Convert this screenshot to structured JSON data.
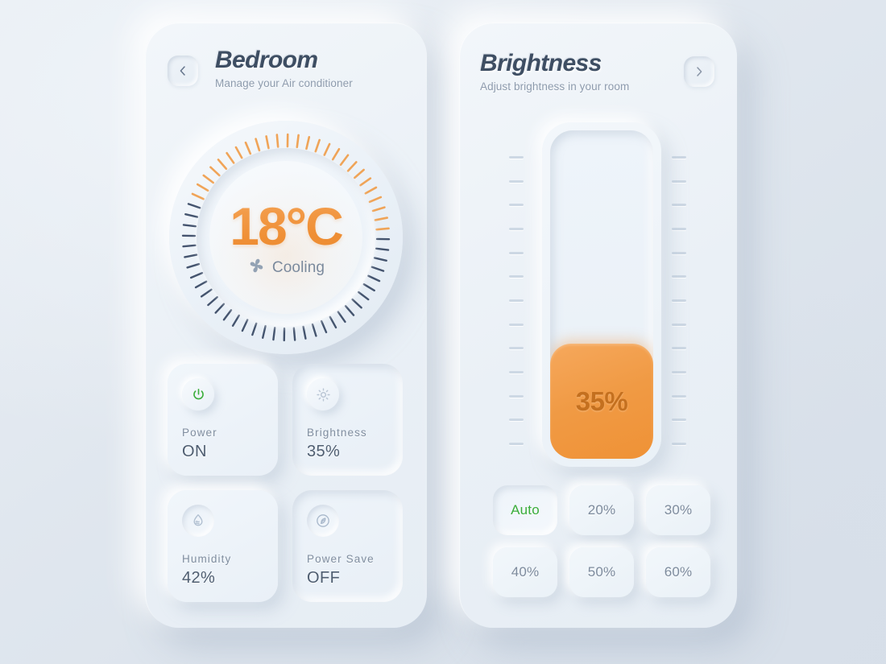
{
  "theme": {
    "background": "#e3eaf2",
    "panel": "#eef3f9",
    "accent_orange": "#f09a44",
    "accent_orange_dark": "#c4701f",
    "accent_green": "#3aad3a",
    "text_dark": "#3e4e63",
    "text_muted": "#8d9bad",
    "tick_active": "#f0a050",
    "tick_inactive": "#2e3f5c"
  },
  "left_panel": {
    "back_button": {
      "icon": "chevron-left-icon",
      "label": "Back"
    },
    "title": "Bedroom",
    "subtitle": "Manage your Air conditioner",
    "dial": {
      "temperature": "18°C",
      "temperature_value": 18,
      "unit": "°C",
      "mode_icon": "fan-icon",
      "mode": "Cooling",
      "total_ticks": 60,
      "active_ticks": 26
    },
    "cards": [
      {
        "icon": "power-icon",
        "name": "Power",
        "value": "ON",
        "icon_color": "#3aad3a",
        "style": "raised",
        "icon_style": "raised"
      },
      {
        "icon": "sun-icon",
        "name": "Brightness",
        "value": "35%",
        "icon_color": "#b9c5d4",
        "style": "inset",
        "icon_style": "raised"
      },
      {
        "icon": "humidity-icon",
        "name": "Humidity",
        "value": "42%",
        "icon_color": "#b0bfd0",
        "style": "raised",
        "icon_style": "inset"
      },
      {
        "icon": "power-save-icon",
        "name": "Power Save",
        "value": "OFF",
        "icon_color": "#a8b8cb",
        "style": "inset",
        "icon_style": "inset"
      }
    ]
  },
  "right_panel": {
    "forward_button": {
      "icon": "chevron-right-icon",
      "label": "Next"
    },
    "title": "Brightness",
    "subtitle": "Adjust brightness in your room",
    "slider": {
      "value": 35,
      "value_label": "35%",
      "min": 0,
      "max": 100,
      "rail_ticks": 13
    },
    "presets": [
      {
        "label": "Auto",
        "active": true
      },
      {
        "label": "20%",
        "active": false
      },
      {
        "label": "30%",
        "active": false
      },
      {
        "label": "40%",
        "active": false
      },
      {
        "label": "50%",
        "active": false
      },
      {
        "label": "60%",
        "active": false
      }
    ]
  }
}
